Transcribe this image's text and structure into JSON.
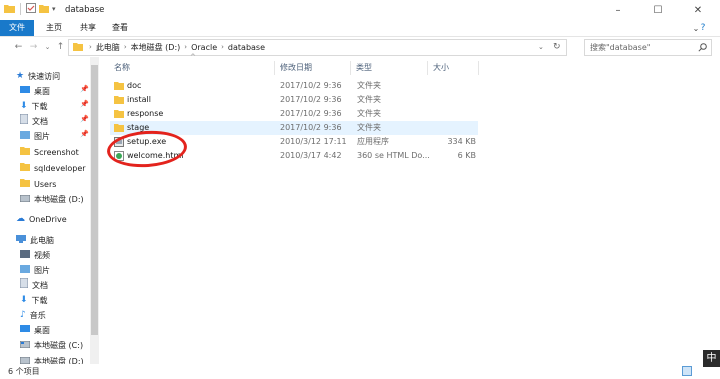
{
  "window": {
    "title": "database"
  },
  "ribbon": {
    "tabs": [
      "文件",
      "主页",
      "共享",
      "查看"
    ]
  },
  "address": {
    "crumbs": [
      "此电脑",
      "本地磁盘 (D:)",
      "Oracle",
      "database"
    ]
  },
  "search": {
    "placeholder": "搜索\"database\""
  },
  "sidebar": {
    "quick_access": "快速访问",
    "pinned": [
      "桌面",
      "下载",
      "文档",
      "图片"
    ],
    "folders": [
      "Screenshot",
      "sqldeveloper",
      "Users",
      "本地磁盘 (D:)"
    ],
    "onedrive": "OneDrive",
    "this_pc": "此电脑",
    "pc_items": [
      "视频",
      "图片",
      "文档",
      "下载",
      "音乐",
      "桌面",
      "本地磁盘 (C:)",
      "本地磁盘 (D:)"
    ]
  },
  "columns": {
    "name": "名称",
    "date": "修改日期",
    "type": "类型",
    "size": "大小"
  },
  "files": [
    {
      "name": "doc",
      "date": "2017/10/2 9:36",
      "type": "文件夹",
      "size": "",
      "icon": "folder"
    },
    {
      "name": "install",
      "date": "2017/10/2 9:36",
      "type": "文件夹",
      "size": "",
      "icon": "folder"
    },
    {
      "name": "response",
      "date": "2017/10/2 9:36",
      "type": "文件夹",
      "size": "",
      "icon": "folder"
    },
    {
      "name": "stage",
      "date": "2017/10/2 9:36",
      "type": "文件夹",
      "size": "",
      "icon": "folder"
    },
    {
      "name": "setup.exe",
      "date": "2010/3/12 17:11",
      "type": "应用程序",
      "size": "334 KB",
      "icon": "exe"
    },
    {
      "name": "welcome.html",
      "date": "2010/3/17 4:42",
      "type": "360 se HTML Do...",
      "size": "6 KB",
      "icon": "html"
    }
  ],
  "status": {
    "count": "6 个项目"
  },
  "ime": {
    "label": "中"
  },
  "colors": {
    "accent": "#1979ca",
    "selection": "#e5f3ff",
    "highlight_circle": "#e3231d",
    "folder": "#f5c342"
  }
}
